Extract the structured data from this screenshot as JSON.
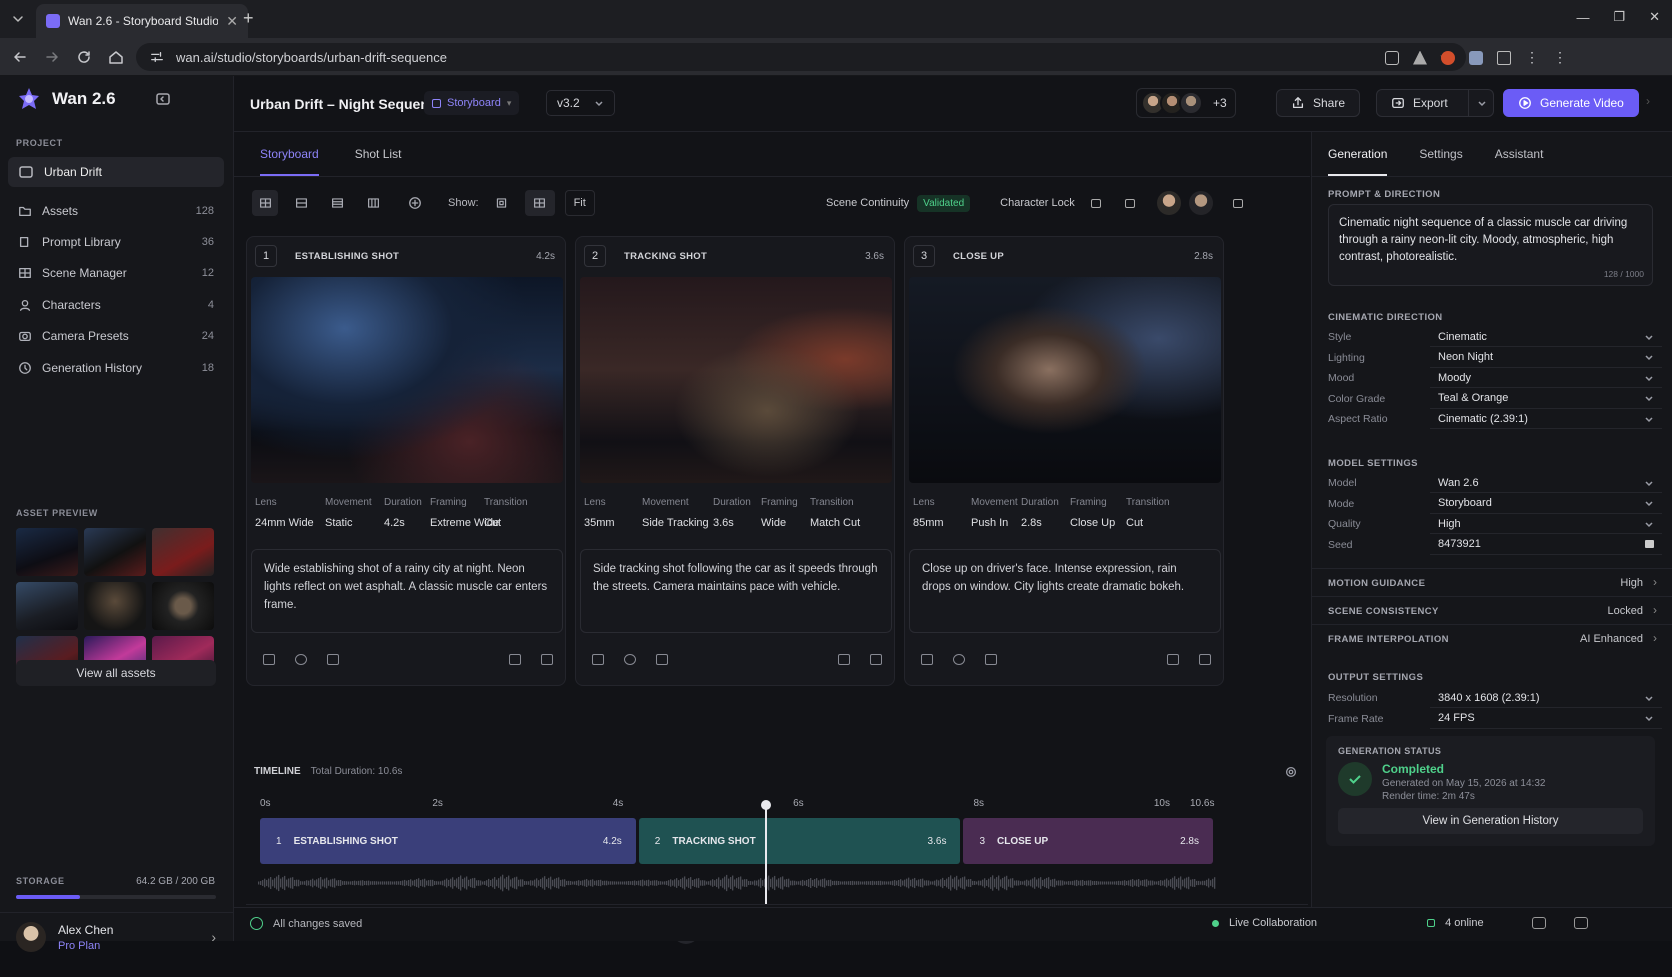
{
  "browser": {
    "tab_title": "Wan 2.6 - Storyboard Studio",
    "url": "wan.ai/studio/storyboards/urban-drift-sequence"
  },
  "app": {
    "name": "Wan 2.6",
    "accent": "#6b5cf6"
  },
  "sidebar": {
    "project_label": "PROJECT",
    "project_name": "Urban Drift",
    "items": [
      {
        "label": "Assets",
        "count": "128",
        "icon": "folder-icon"
      },
      {
        "label": "Prompt Library",
        "count": "36",
        "icon": "book-icon"
      },
      {
        "label": "Scene Manager",
        "count": "12",
        "icon": "grid-icon"
      },
      {
        "label": "Characters",
        "count": "4",
        "icon": "user-icon"
      },
      {
        "label": "Camera Presets",
        "count": "24",
        "icon": "camera-icon"
      },
      {
        "label": "Generation History",
        "count": "18",
        "icon": "history-icon"
      }
    ],
    "asset_preview_label": "ASSET PREVIEW",
    "view_all": "View all assets",
    "storage_label": "STORAGE",
    "storage_value": "64.2 GB / 200 GB",
    "storage_fraction": 0.321,
    "user": {
      "name": "Alex Chen",
      "plan": "Pro Plan"
    }
  },
  "header": {
    "title": "Urban Drift – Night Sequence",
    "mode": "Storyboard",
    "version": "v3.2",
    "extra_collaborators": "+3",
    "share": "Share",
    "export": "Export",
    "generate": "Generate Video"
  },
  "main": {
    "tabs": [
      "Storyboard",
      "Shot List"
    ],
    "show_label": "Show:",
    "fit": "Fit",
    "scene_continuity": "Scene Continuity",
    "validated": "Validated",
    "character_lock": "Character Lock",
    "meta_keys": [
      "Lens",
      "Movement",
      "Duration",
      "Framing",
      "Transition"
    ],
    "shots": [
      {
        "num": "1",
        "title": "ESTABLISHING SHOT",
        "dur": "4.2s",
        "lens": "24mm Wide",
        "movement": "Static",
        "duration": "4.2s",
        "framing": "Extreme Wide",
        "transition": "Cut",
        "desc": "Wide establishing shot of a rainy city at night. Neon lights reflect on wet asphalt. A classic muscle car enters frame."
      },
      {
        "num": "2",
        "title": "TRACKING SHOT",
        "dur": "3.6s",
        "lens": "35mm",
        "movement": "Side Tracking",
        "duration": "3.6s",
        "framing": "Wide",
        "transition": "Match Cut",
        "desc": "Side tracking shot following the car as it speeds through the streets. Camera maintains pace with vehicle."
      },
      {
        "num": "3",
        "title": "CLOSE UP",
        "dur": "2.8s",
        "lens": "85mm",
        "movement": "Push In",
        "duration": "2.8s",
        "framing": "Close Up",
        "transition": "Cut",
        "desc": "Close up on driver's face. Intense expression, rain drops on window. City lights create dramatic bokeh."
      }
    ]
  },
  "timeline": {
    "label": "TIMELINE",
    "total": "Total Duration: 10.6s",
    "ticks": [
      "0s",
      "2s",
      "4s",
      "6s",
      "8s",
      "10s",
      "10.6s"
    ],
    "tick_values": [
      0,
      2,
      4,
      6,
      8,
      10,
      10.6
    ],
    "playhead": 5.6,
    "zoom_fraction": 0.6,
    "clips": [
      {
        "num": "1",
        "title": "ESTABLISHING SHOT",
        "dur": "4.2s",
        "start": 0,
        "end": 4.2,
        "color": "#3a3f7a"
      },
      {
        "num": "2",
        "title": "TRACKING SHOT",
        "dur": "3.6s",
        "start": 4.2,
        "end": 7.8,
        "color": "#1f5252"
      },
      {
        "num": "3",
        "title": "CLOSE UP",
        "dur": "2.8s",
        "start": 7.8,
        "end": 10.6,
        "color": "#4a2c52"
      }
    ]
  },
  "right": {
    "tabs": [
      "Generation",
      "Settings",
      "Assistant"
    ],
    "prompt_label": "PROMPT & DIRECTION",
    "prompt": "Cinematic night sequence of a classic muscle car driving through a rainy neon-lit city. Moody, atmospheric, high contrast, photorealistic.",
    "prompt_count": "128 / 1000",
    "cinematic_label": "CINEMATIC DIRECTION",
    "cinematic": [
      {
        "k": "Style",
        "v": "Cinematic"
      },
      {
        "k": "Lighting",
        "v": "Neon Night"
      },
      {
        "k": "Mood",
        "v": "Moody"
      },
      {
        "k": "Color Grade",
        "v": "Teal & Orange"
      },
      {
        "k": "Aspect Ratio",
        "v": "Cinematic (2.39:1)"
      }
    ],
    "model_label": "MODEL SETTINGS",
    "model": [
      {
        "k": "Model",
        "v": "Wan 2.6"
      },
      {
        "k": "Mode",
        "v": "Storyboard"
      },
      {
        "k": "Quality",
        "v": "High"
      },
      {
        "k": "Seed",
        "v": "8473921"
      }
    ],
    "collapsibles": [
      {
        "k": "MOTION GUIDANCE",
        "v": "High"
      },
      {
        "k": "SCENE CONSISTENCY",
        "v": "Locked"
      },
      {
        "k": "FRAME INTERPOLATION",
        "v": "AI Enhanced"
      }
    ],
    "output_label": "OUTPUT SETTINGS",
    "output": [
      {
        "k": "Resolution",
        "v": "3840 x 1608 (2.39:1)"
      },
      {
        "k": "Frame Rate",
        "v": "24 FPS"
      }
    ],
    "status_label": "GENERATION STATUS",
    "status": "Completed",
    "status_date": "Generated on May 15, 2026 at 14:32",
    "render_time": "Render time: 2m 47s",
    "view_history": "View in Generation History"
  },
  "status": {
    "saved": "All changes saved",
    "collab": "Live Collaboration",
    "online": "4 online"
  }
}
